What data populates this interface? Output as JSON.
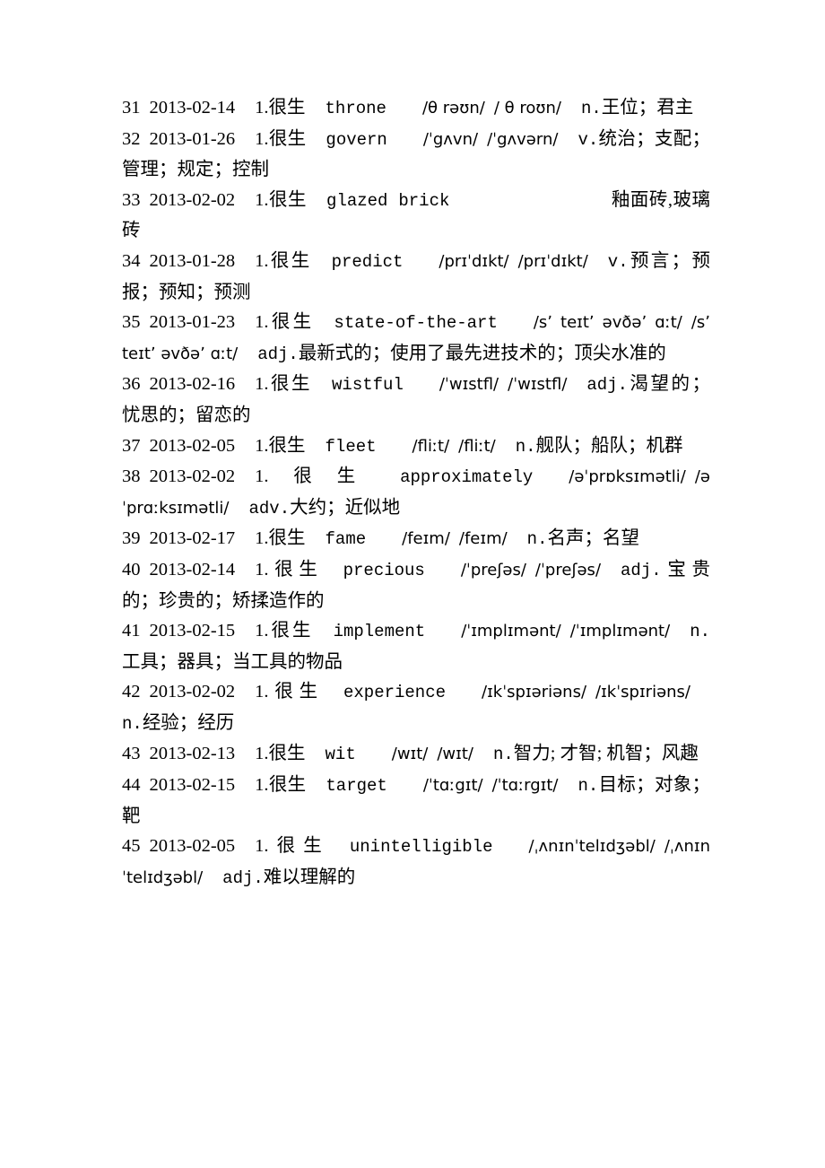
{
  "document": {
    "type": "vocabulary-word-list",
    "language_pair": "English-Chinese",
    "entries": [
      {
        "index": "31",
        "date": "2013-02-14",
        "familiarity": "1.很生",
        "word": "throne",
        "ipa_uk": "/θ rəʊn/",
        "ipa_us": "/ θ roʊn/",
        "pos": "n.",
        "meaning": "王位；君主"
      },
      {
        "index": "32",
        "date": "2013-01-26",
        "familiarity": "1.很生",
        "word": "govern",
        "ipa_uk": "/ˈgʌvn/",
        "ipa_us": "/ˈgʌvərn/",
        "pos": "v.",
        "meaning": "统治；支配；管理；规定；控制"
      },
      {
        "index": "33",
        "date": "2013-02-02",
        "familiarity": "1.很生",
        "word": "glazed brick",
        "ipa_uk": "",
        "ipa_us": "",
        "pos": "",
        "meaning": "釉面砖,玻璃砖"
      },
      {
        "index": "34",
        "date": "2013-01-28",
        "familiarity": "1.很生",
        "word": "predict",
        "ipa_uk": "/prɪˈdɪkt/",
        "ipa_us": "/prɪˈdɪkt/",
        "pos": "v.",
        "meaning": "预言；预报；预知；预测"
      },
      {
        "index": "35",
        "date": "2013-01-23",
        "familiarity": "1.很生",
        "word": "state-of-the-art",
        "ipa_uk": "/sʼ teɪtʼ əvðəʼ ɑːt/",
        "ipa_us": "/sʼ teɪtʼ əvðəʼ ɑːt/",
        "pos": "adj.",
        "meaning": "最新式的；使用了最先进技术的；顶尖水准的"
      },
      {
        "index": "36",
        "date": "2013-02-16",
        "familiarity": "1.很生",
        "word": "wistful",
        "ipa_uk": "/ˈwɪstfl/",
        "ipa_us": "/ˈwɪstfl/",
        "pos": "adj.",
        "meaning": "渴望的；忧思的；留恋的"
      },
      {
        "index": "37",
        "date": "2013-02-05",
        "familiarity": "1.很生",
        "word": "fleet",
        "ipa_uk": "/fliːt/",
        "ipa_us": "/fliːt/",
        "pos": "n.",
        "meaning": "舰队；船队；机群"
      },
      {
        "index": "38",
        "date": "2013-02-02",
        "familiarity": "1.很生",
        "word": "approximately",
        "ipa_uk": "/əˈprɒksɪmətli/",
        "ipa_us": "/əˈprɑːksɪmətli/",
        "pos": "adv.",
        "meaning": "大约；近似地"
      },
      {
        "index": "39",
        "date": "2013-02-17",
        "familiarity": "1.很生",
        "word": "fame",
        "ipa_uk": "/feɪm/",
        "ipa_us": "/feɪm/",
        "pos": "n.",
        "meaning": "名声；名望"
      },
      {
        "index": "40",
        "date": "2013-02-14",
        "familiarity": "1.很生",
        "word": "precious",
        "ipa_uk": "/ˈpreʃəs/",
        "ipa_us": "/ˈpreʃəs/",
        "pos": "adj.",
        "meaning": "宝贵的；珍贵的；矫揉造作的"
      },
      {
        "index": "41",
        "date": "2013-02-15",
        "familiarity": "1.很生",
        "word": "implement",
        "ipa_uk": "/ˈɪmplɪmənt/",
        "ipa_us": "/ˈɪmplɪmənt/",
        "pos": "n.",
        "meaning": "工具；器具；当工具的物品"
      },
      {
        "index": "42",
        "date": "2013-02-02",
        "familiarity": "1.很生",
        "word": "experience",
        "ipa_uk": "/ɪkˈspɪəriəns/",
        "ipa_us": "/ɪkˈspɪriəns/",
        "pos": "n.",
        "meaning": "经验；经历"
      },
      {
        "index": "43",
        "date": "2013-02-13",
        "familiarity": "1.很生",
        "word": "wit",
        "ipa_uk": "/wɪt/",
        "ipa_us": "/wɪt/",
        "pos": "n.",
        "meaning": "智力; 才智; 机智；风趣"
      },
      {
        "index": "44",
        "date": "2013-02-15",
        "familiarity": "1.很生",
        "word": "target",
        "ipa_uk": "/ˈtɑːgɪt/",
        "ipa_us": "/ˈtɑːrgɪt/",
        "pos": "n.",
        "meaning": "目标；对象；靶"
      },
      {
        "index": "45",
        "date": "2013-02-05",
        "familiarity": "1.很生",
        "word": "unintelligible",
        "ipa_uk": "/ˌʌnɪnˈtelɪdʒəbl/",
        "ipa_us": "/ˌʌnɪnˈtelɪdʒəbl/",
        "pos": "adj.",
        "meaning": "难以理解的"
      }
    ]
  }
}
